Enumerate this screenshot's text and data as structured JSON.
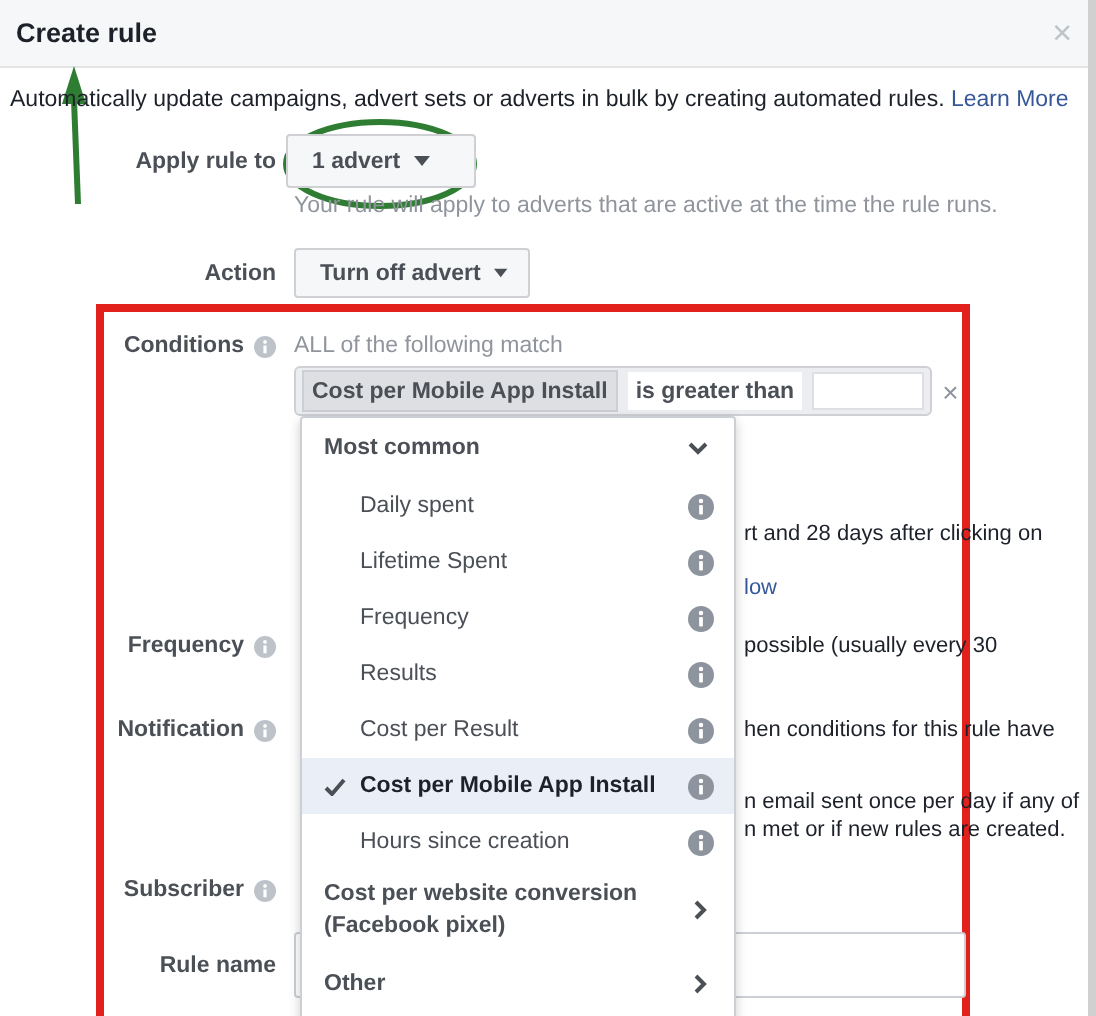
{
  "dialog": {
    "title": "Create rule",
    "close": "×"
  },
  "intro": {
    "text": "Automatically update campaigns, advert sets or adverts in bulk by creating automated rules.",
    "link": "Learn More"
  },
  "apply_rule": {
    "label": "Apply rule to",
    "value": "1 advert",
    "hint": "Your rule will apply to adverts that are active at the time the rule runs."
  },
  "action": {
    "label": "Action",
    "value": "Turn off advert"
  },
  "conditions": {
    "label": "Conditions",
    "match": "ALL of the following match",
    "metric": "Cost per Mobile App Install",
    "operator": "is greater than",
    "remove": "×",
    "partial_lines": [
      {
        "kind": "text",
        "text": "rt and 28 days after clicking on"
      },
      {
        "kind": "link",
        "text": "low"
      }
    ]
  },
  "frequency": {
    "label": "Frequency",
    "partial_lines": [
      {
        "kind": "text",
        "text": "possible (usually every 30"
      }
    ]
  },
  "notification": {
    "label": "Notification",
    "partial_lines": [
      {
        "kind": "text",
        "text": "hen conditions for this rule have"
      },
      {
        "kind": "text",
        "text": "n email sent once per day if any of"
      },
      {
        "kind": "text",
        "text": "n met or if new rules are created."
      }
    ]
  },
  "subscriber": {
    "label": "Subscriber"
  },
  "rule_name": {
    "label": "Rule name"
  },
  "dropdown": {
    "groups": [
      {
        "label": "Most common",
        "expanded": true,
        "items": [
          {
            "label": "Daily spent",
            "selected": false
          },
          {
            "label": "Lifetime Spent",
            "selected": false
          },
          {
            "label": "Frequency",
            "selected": false
          },
          {
            "label": "Results",
            "selected": false
          },
          {
            "label": "Cost per Result",
            "selected": false
          },
          {
            "label": "Cost per Mobile App Install",
            "selected": true
          },
          {
            "label": "Hours since creation",
            "selected": false
          }
        ]
      },
      {
        "label": "Cost per website conversion (Facebook pixel)",
        "expanded": false
      },
      {
        "label": "Other",
        "expanded": false
      }
    ]
  }
}
